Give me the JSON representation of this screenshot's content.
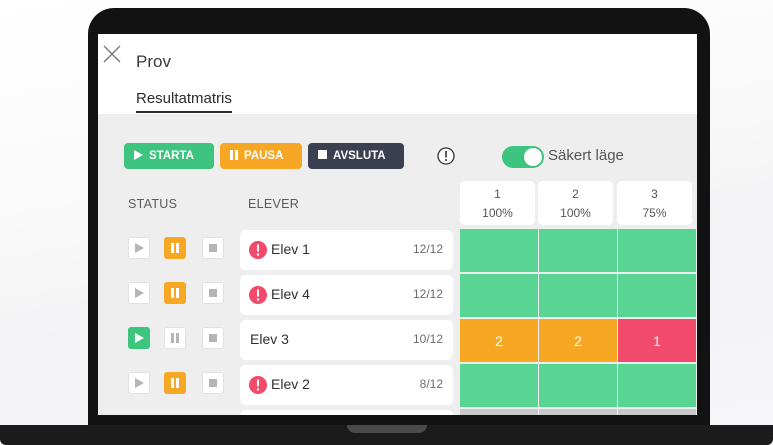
{
  "window": {
    "title": "Prov",
    "tab": "Resultatmatris"
  },
  "toolbar": {
    "start_label": "STARTA",
    "pause_label": "PAUSA",
    "stop_label": "AVSLUTA",
    "safe_mode_label": "Säkert läge",
    "safe_mode_on": true
  },
  "columns": {
    "status": "STATUS",
    "students": "ELEVER"
  },
  "questions": [
    {
      "number": "1",
      "percent": "100%"
    },
    {
      "number": "2",
      "percent": "100%"
    },
    {
      "number": "3",
      "percent": "75%"
    }
  ],
  "rows": [
    {
      "name": "Elev 1",
      "score": "12/12",
      "warning": true,
      "state": "paused",
      "cells": [
        {
          "value": "",
          "status": "correct"
        },
        {
          "value": "",
          "status": "correct"
        },
        {
          "value": "",
          "status": "correct"
        }
      ]
    },
    {
      "name": "Elev 4",
      "score": "12/12",
      "warning": true,
      "state": "paused",
      "cells": [
        {
          "value": "",
          "status": "correct"
        },
        {
          "value": "",
          "status": "correct"
        },
        {
          "value": "",
          "status": "correct"
        }
      ]
    },
    {
      "name": "Elev 3",
      "score": "10/12",
      "warning": false,
      "state": "playing",
      "cells": [
        {
          "value": "2",
          "status": "partial"
        },
        {
          "value": "2",
          "status": "partial"
        },
        {
          "value": "1",
          "status": "wrong"
        }
      ]
    },
    {
      "name": "Elev 2",
      "score": "8/12",
      "warning": true,
      "state": "paused",
      "cells": [
        {
          "value": "",
          "status": "correct"
        },
        {
          "value": "",
          "status": "correct"
        },
        {
          "value": "",
          "status": "correct"
        }
      ]
    }
  ],
  "colors": {
    "correct": "#58d493",
    "partial": "#f6a724",
    "wrong": "#f24a6b",
    "accent_green": "#3dc47e",
    "dark": "#3b3f50"
  },
  "icons": [
    "close-icon",
    "play-icon",
    "pause-icon",
    "stop-icon",
    "info-icon",
    "warning-icon"
  ]
}
